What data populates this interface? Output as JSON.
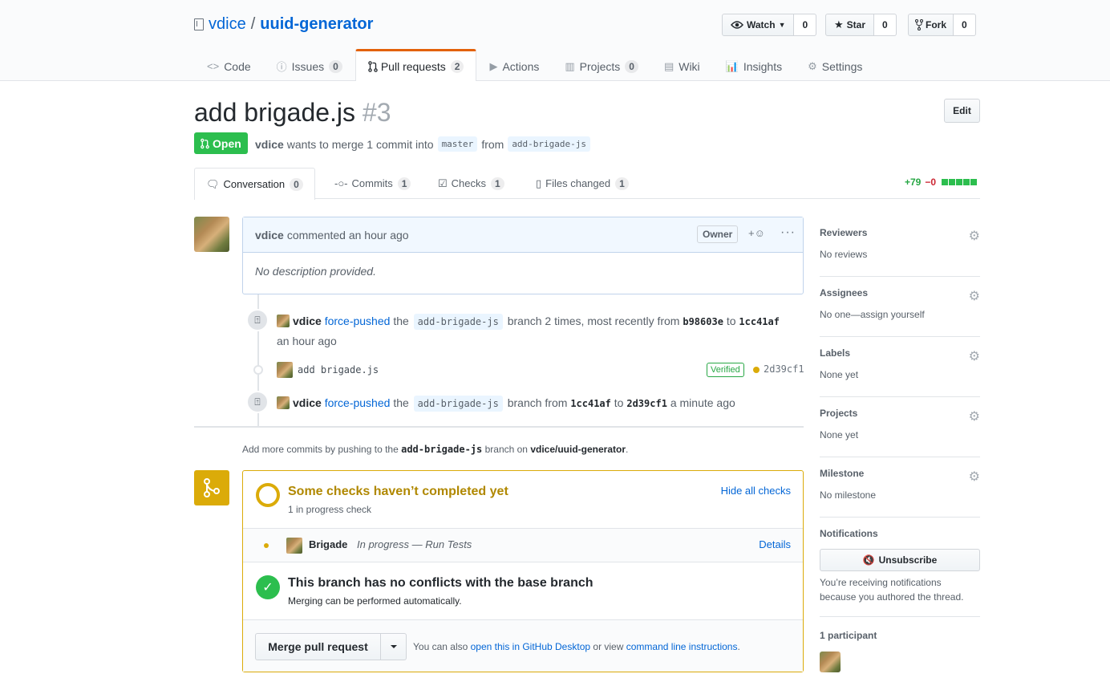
{
  "repo": {
    "owner": "vdice",
    "separator": "/",
    "name": "uuid-generator"
  },
  "actions": [
    {
      "label": "Watch",
      "count": "0",
      "icon": "eye-icon"
    },
    {
      "label": "Star",
      "count": "0",
      "icon": "star-icon"
    },
    {
      "label": "Fork",
      "count": "0",
      "icon": "fork-icon"
    }
  ],
  "nav": {
    "code": "Code",
    "issues": "Issues",
    "issues_count": "0",
    "pulls": "Pull requests",
    "pulls_count": "2",
    "actions": "Actions",
    "projects": "Projects",
    "projects_count": "0",
    "wiki": "Wiki",
    "insights": "Insights",
    "settings": "Settings"
  },
  "pr": {
    "title": "add brigade.js",
    "number": "#3",
    "edit": "Edit",
    "state": "Open",
    "author": "vdice",
    "merge_text": "wants to merge 1 commit into",
    "base": "master",
    "from_text": "from",
    "head": "add-brigade-js"
  },
  "tabs": {
    "conversation": "Conversation",
    "conversation_count": "0",
    "commits": "Commits",
    "commits_count": "1",
    "checks": "Checks",
    "checks_count": "1",
    "files": "Files changed",
    "files_count": "1"
  },
  "diffstat": {
    "additions": "+79",
    "deletions": "−0"
  },
  "comment": {
    "author": "vdice",
    "meta": "commented an hour ago",
    "badge": "Owner",
    "reaction": "+☺",
    "more": "···",
    "body": "No description provided."
  },
  "events": {
    "e1": {
      "author": "vdice",
      "action": "force-pushed",
      "the": "the",
      "branch": "add-brigade-js",
      "text": "branch 2 times, most recently from",
      "from": "b98603e",
      "to_word": "to",
      "to": "1cc41af",
      "time": "an hour ago"
    },
    "commit": {
      "message": "add brigade.js",
      "verified": "Verified",
      "sha": "2d39cf1"
    },
    "e2": {
      "author": "vdice",
      "action": "force-pushed",
      "the": "the",
      "branch": "add-brigade-js",
      "text": "branch from",
      "from": "1cc41af",
      "to_word": "to",
      "to": "2d39cf1",
      "time": "a minute ago"
    }
  },
  "push_note": {
    "pre": "Add more commits by pushing to the",
    "branch": "add-brigade-js",
    "mid": "branch on",
    "repo": "vdice/uuid-generator",
    "end": "."
  },
  "merge": {
    "checks_title": "Some checks haven’t completed yet",
    "checks_sub": "1 in progress check",
    "hide": "Hide all checks",
    "check_name": "Brigade",
    "check_status": "In progress — Run Tests",
    "details": "Details",
    "ok_title": "This branch has no conflicts with the base branch",
    "ok_sub": "Merging can be performed automatically.",
    "button": "Merge pull request",
    "alt_pre": "You can also",
    "alt_link1": "open this in GitHub Desktop",
    "alt_mid": "or view",
    "alt_link2": "command line instructions",
    "alt_end": "."
  },
  "sidebar": {
    "reviewers": "Reviewers",
    "reviewers_val": "No reviews",
    "assignees": "Assignees",
    "assignees_val": "No one—assign yourself",
    "labels": "Labels",
    "labels_val": "None yet",
    "projects": "Projects",
    "projects_val": "None yet",
    "milestone": "Milestone",
    "milestone_val": "No milestone",
    "notifications": "Notifications",
    "unsubscribe": "Unsubscribe",
    "notif_reason": "You’re receiving notifications because you authored the thread.",
    "participants": "1 participant"
  },
  "colors": {
    "accent": "#e36209",
    "link": "#0366d6",
    "open": "#2cbe4e",
    "pending": "#dbab09"
  }
}
